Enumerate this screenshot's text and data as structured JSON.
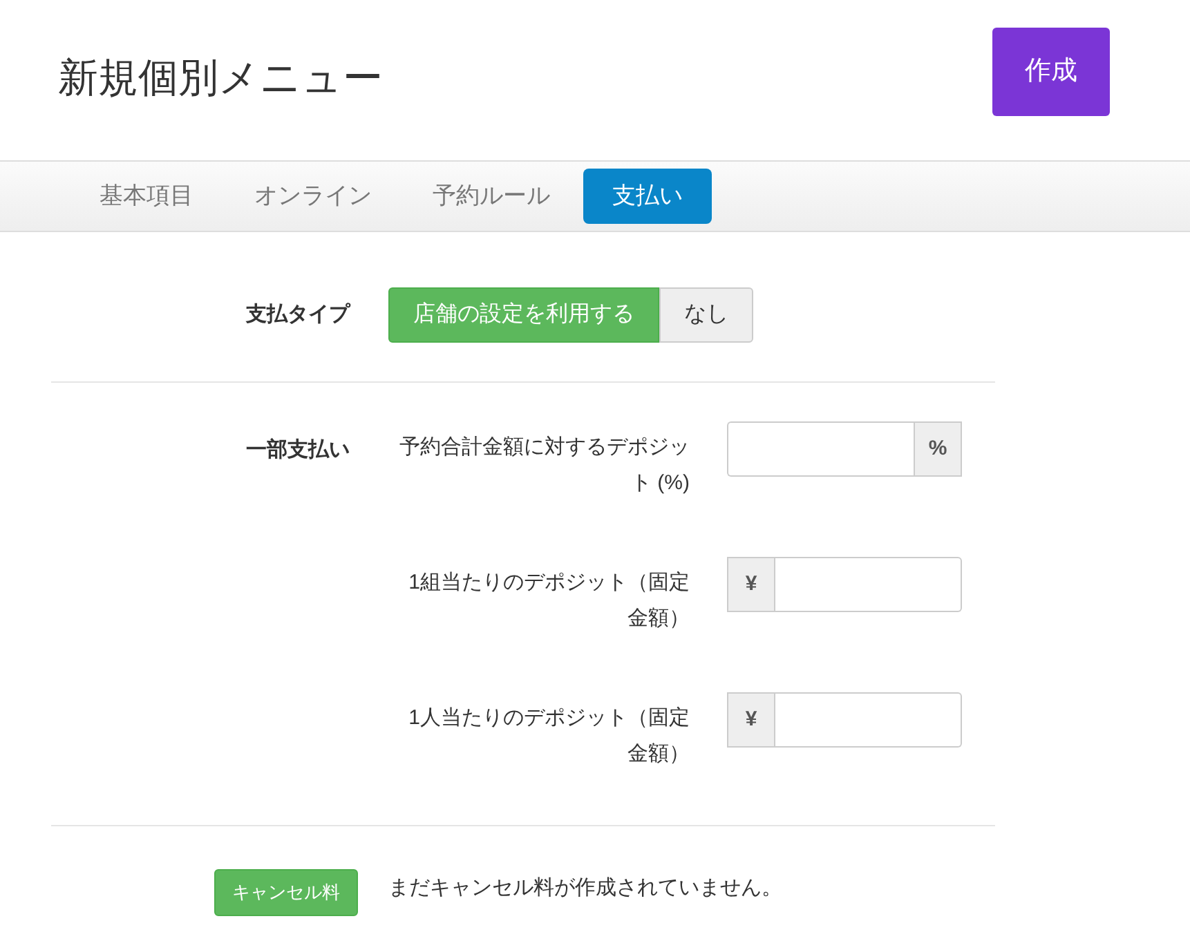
{
  "header": {
    "title": "新規個別メニュー",
    "create_button": "作成"
  },
  "tabs": [
    {
      "label": "基本項目",
      "selected": false
    },
    {
      "label": "オンライン",
      "selected": false
    },
    {
      "label": "予約ルール",
      "selected": false
    },
    {
      "label": "支払い",
      "selected": true
    }
  ],
  "payment_type": {
    "label": "支払タイプ",
    "options": [
      {
        "label": "店舗の設定を利用する",
        "selected": true
      },
      {
        "label": "なし",
        "selected": false
      }
    ]
  },
  "partial_payment": {
    "label": "一部支払い",
    "fields": [
      {
        "label": "予約合計金額に対するデポジット (%)",
        "kind": "suffix",
        "addon": "%"
      },
      {
        "label": "1組当たりのデポジット（固定金額）",
        "kind": "prefix",
        "addon": "¥"
      },
      {
        "label": "1人当たりのデポジット（固定金額）",
        "kind": "prefix",
        "addon": "¥"
      }
    ]
  },
  "cancellation": {
    "button": "キャンセル料",
    "message": "まだキャンセル料が作成されていません。"
  }
}
